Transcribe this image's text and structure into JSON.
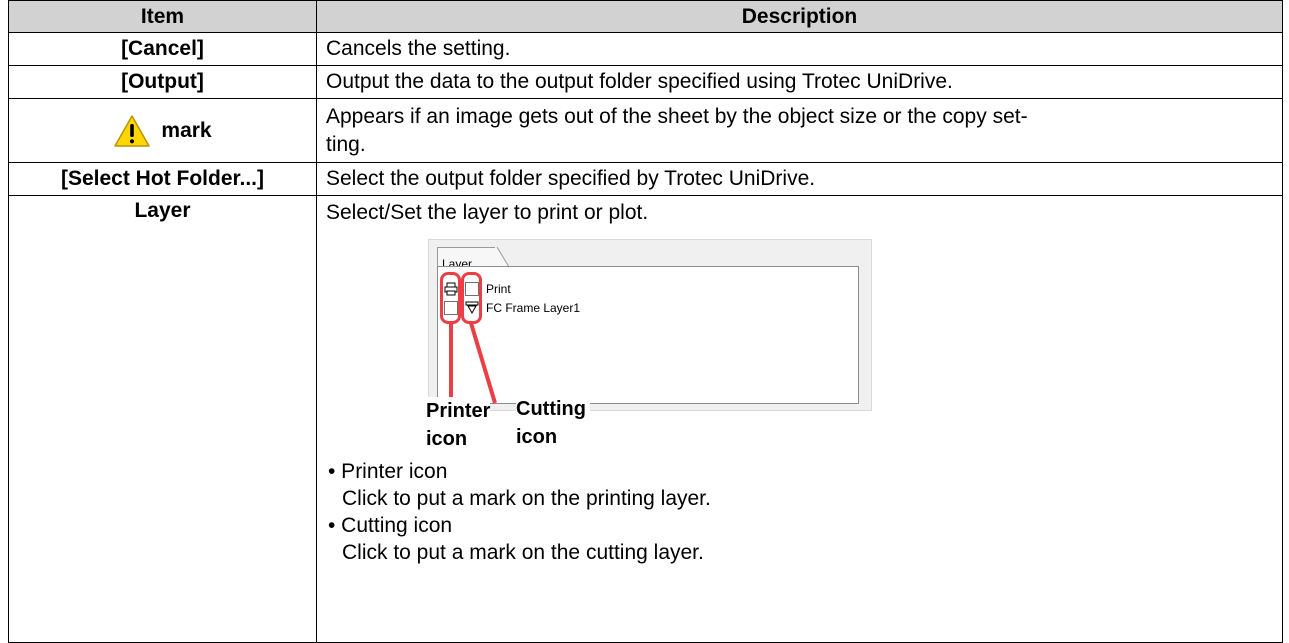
{
  "header": {
    "item": "Item",
    "description": "Description"
  },
  "rows": [
    {
      "item": "[Cancel]",
      "description": "Cancels the setting."
    },
    {
      "item": "[Output]",
      "description": "Output the data to the output folder specified using Trotec UniDrive."
    },
    {
      "item": "mark",
      "icon": "warning-triangle-icon",
      "description_line1": "Appears if an image gets out of the sheet by the object size or the copy set-",
      "description_line2": "ting."
    },
    {
      "item": "[Select Hot Folder...]",
      "description": "Select the output folder specified by Trotec UniDrive."
    },
    {
      "item": "Layer",
      "description": "Select/Set the layer to print or plot."
    }
  ],
  "layer_panel": {
    "tab_label": "Layer",
    "layers": [
      "Print",
      "FC Frame Layer1"
    ],
    "callouts": {
      "printer_line1": "Printer",
      "printer_line2": "icon",
      "cutting_line1": "Cutting",
      "cutting_line2": "icon"
    }
  },
  "bullets": [
    {
      "title": "• Printer icon",
      "text": "Click to put a mark on the printing layer."
    },
    {
      "title": "• Cutting icon",
      "text": "Click to put a mark on the cutting layer."
    }
  ],
  "colors": {
    "header_bg": "#d2d2d2",
    "highlight": "#ec3f45",
    "warning": "#ffd700"
  }
}
